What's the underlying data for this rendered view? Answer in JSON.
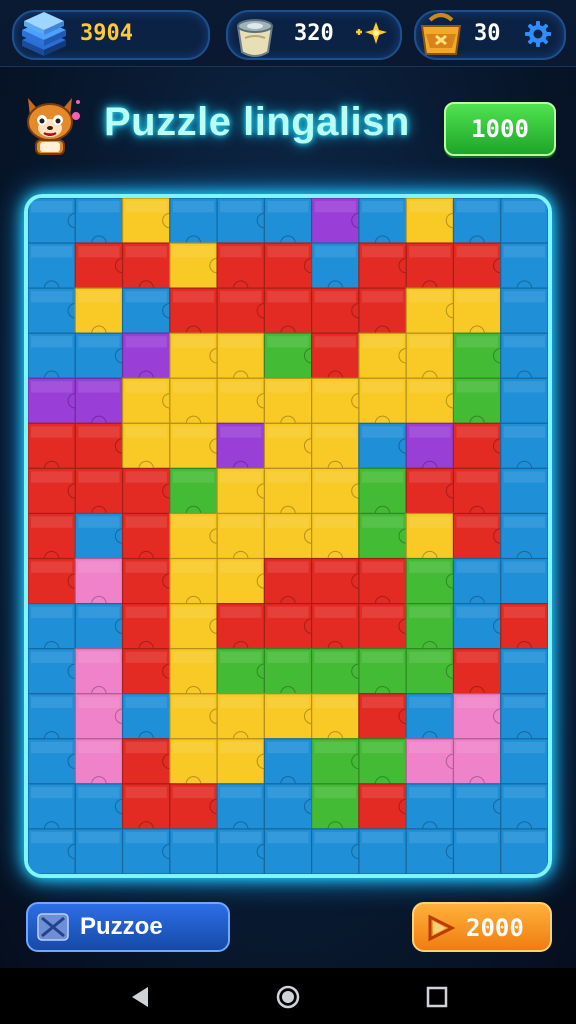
{
  "resources": {
    "gold": "3904",
    "scrolls": "320",
    "bags": "30"
  },
  "header": {
    "title": "Puzzle lingalisn",
    "score_button": "1000"
  },
  "board": {
    "rows": 15,
    "cols": 11,
    "colors": {
      "R": "#e32b24",
      "Y": "#f9c925",
      "G": "#44bb35",
      "B": "#1f8fd8",
      "P": "#9a3ed8",
      "K": "#f082c9",
      "O": "#f26a1b"
    },
    "grid": [
      "BBYBBBPBYBB",
      "BRRYRRBRRRB",
      "BYBRRRRRYYB",
      "BBPYYGRYYGB",
      "PPYYYYYYYGB",
      "RRYYPYYBPRB",
      "RRRGYYYGRRB",
      "RBRYYYYGYRB",
      "RKRYYRRRGBB",
      "BBRYRRRRGBR",
      "BKRYGGGGGRB",
      "BKBYYYYRBKB",
      "BKRYYBGGKKB",
      "BBRRBBGRBBB",
      "BBBBBBBBBBB"
    ]
  },
  "footer": {
    "left_button": "Puzzoe",
    "right_button": "2000"
  },
  "icons": [
    "gold-stack-icon",
    "scroll-icon",
    "sparkle-icon",
    "bag-icon",
    "settings-gear-icon",
    "fox-mascot-icon",
    "play-triangle-icon",
    "puzzle-shuffle-icon",
    "nav-back-icon",
    "nav-home-icon",
    "nav-recents-icon"
  ]
}
